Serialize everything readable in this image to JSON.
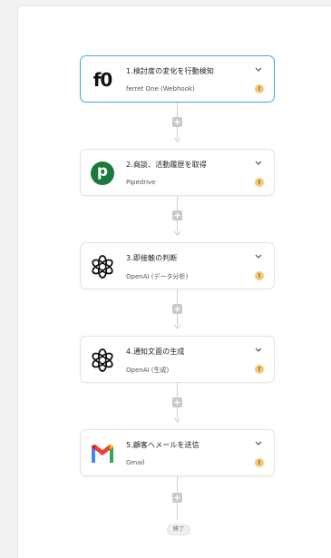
{
  "steps": [
    {
      "title": "1.検討度の変化を行動検知",
      "app": "ferret One (Webhook)",
      "logo": "ferret-one-logo",
      "active": true
    },
    {
      "title": "2.商談、活動履歴を取得",
      "app": "Pipedrive",
      "logo": "pipedrive-logo",
      "active": false
    },
    {
      "title": "3.即接触の判断",
      "app": "OpenAI (データ分析)",
      "logo": "openai-logo",
      "active": false
    },
    {
      "title": "4.通知文面の生成",
      "app": "OpenAI (生成)",
      "logo": "openai-logo",
      "active": false
    },
    {
      "title": "5.顧客へメールを送信",
      "app": "Gmail",
      "logo": "gmail-logo",
      "active": false
    }
  ],
  "end_label": "終了",
  "logo_text": {
    "ferret": "f0",
    "pipedrive": "p"
  },
  "warning_glyph": "!",
  "colors": {
    "active_border": "#49a6dc",
    "pipedrive_green": "#1a7a3c",
    "warning": "#f6c97a",
    "connector": "#c9c9cd"
  }
}
